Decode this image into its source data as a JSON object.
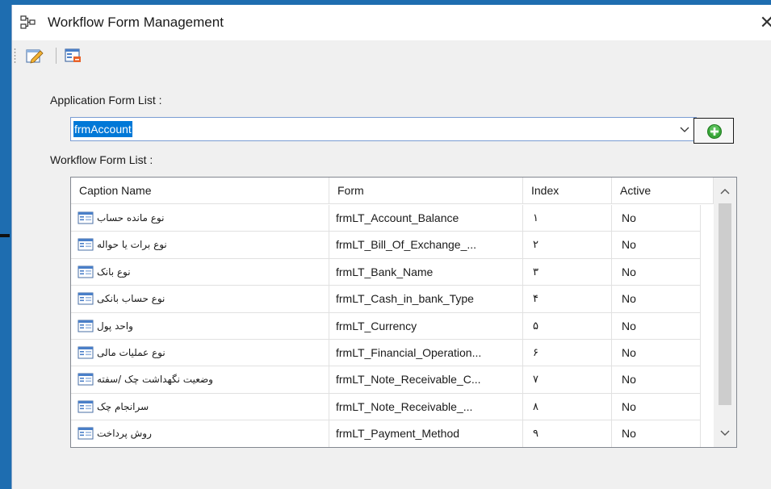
{
  "window": {
    "title": "Workflow Form Management",
    "close_label": "✕"
  },
  "toolbar": {
    "buttons": [
      {
        "name": "edit-button",
        "icon": "edit-pencil-icon"
      },
      {
        "name": "form-list-button",
        "icon": "form-list-icon"
      }
    ]
  },
  "application_form": {
    "label": "Application Form List :",
    "selected": "frmAccount"
  },
  "workflow_form": {
    "label": "Workflow Form List :",
    "columns": [
      "Caption Name",
      "Form",
      "Index",
      "Active"
    ],
    "rows": [
      {
        "caption": "نوع مانده حساب",
        "form": "frmLT_Account_Balance",
        "index": "١",
        "active": "No"
      },
      {
        "caption": "نوع برات یا حواله",
        "form": "frmLT_Bill_Of_Exchange_...",
        "index": "٢",
        "active": "No"
      },
      {
        "caption": "نوع بانک",
        "form": "frmLT_Bank_Name",
        "index": "٣",
        "active": "No"
      },
      {
        "caption": "نوع حساب بانکی",
        "form": "frmLT_Cash_in_bank_Type",
        "index": "۴",
        "active": "No"
      },
      {
        "caption": "واحد پول",
        "form": "frmLT_Currency",
        "index": "۵",
        "active": "No"
      },
      {
        "caption": "نوع عملیات مالی",
        "form": "frmLT_Financial_Operation...",
        "index": "۶",
        "active": "No"
      },
      {
        "caption": "وضعیت نگهداشت چک /سفته",
        "form": "frmLT_Note_Receivable_C...",
        "index": "٧",
        "active": "No"
      },
      {
        "caption": "سرانجام چک",
        "form": "frmLT_Note_Receivable_...",
        "index": "٨",
        "active": "No"
      },
      {
        "caption": "روش پرداخت",
        "form": "frmLT_Payment_Method",
        "index": "٩",
        "active": "No"
      }
    ]
  },
  "colors": {
    "desktop": "#1e6db0",
    "selection": "#0078d7",
    "add_icon": "#3aa63a"
  }
}
